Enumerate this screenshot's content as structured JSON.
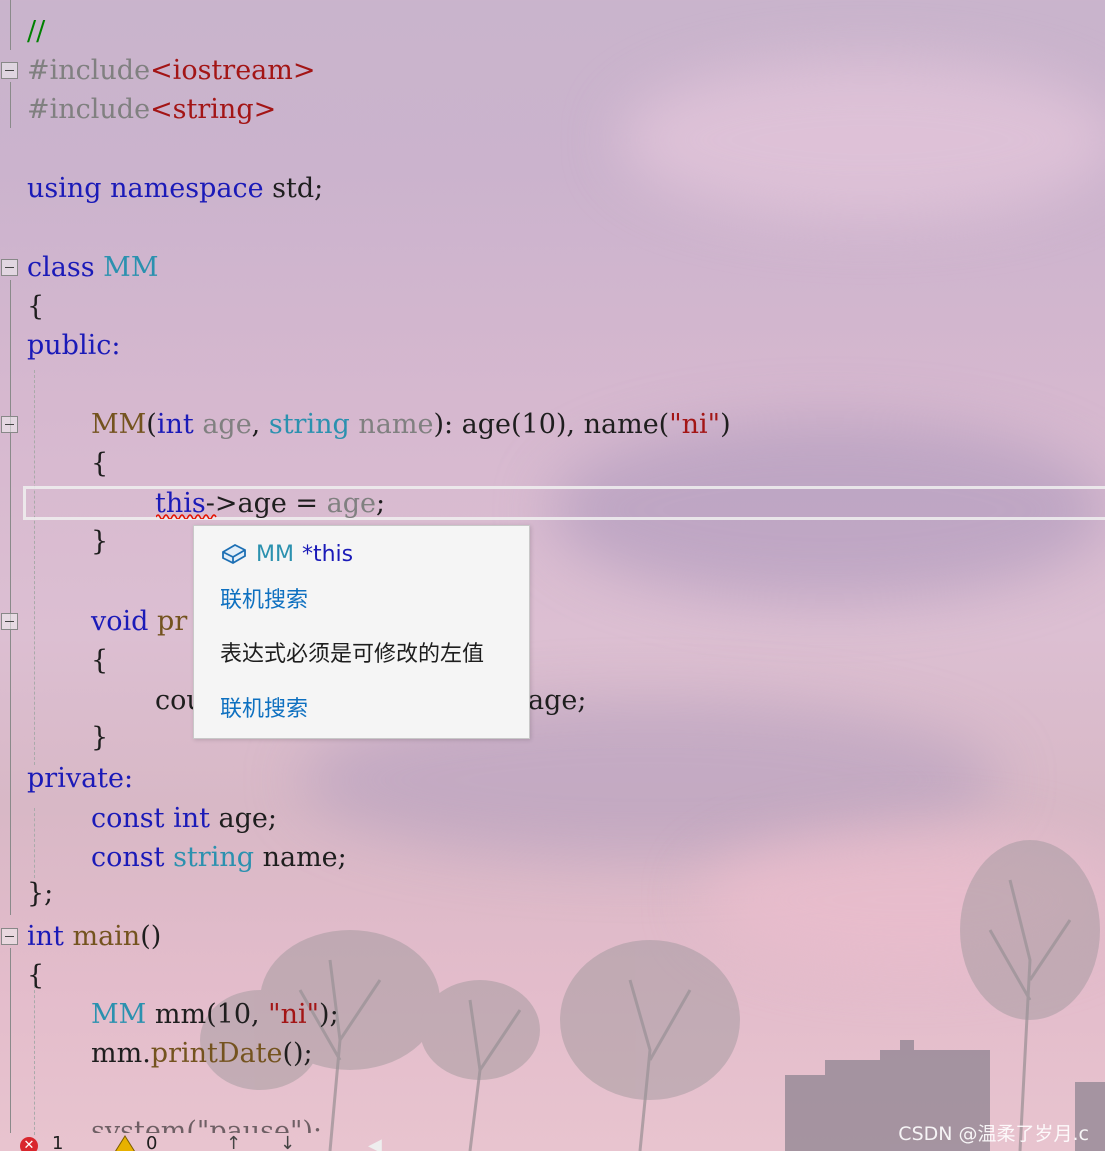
{
  "editor": {
    "code_lines": {
      "l1": "//",
      "l2a": "#include",
      "l2b": "<iostream>",
      "l3a": "#include",
      "l3b": "<string>",
      "l4a": "using",
      "l4b": "namespace",
      "l4c": "std;",
      "l5a": "class",
      "l5b": "MM",
      "l6": "{",
      "l7": "public:",
      "l8a": "MM",
      "l8b": "(",
      "l8c": "int",
      "l8d": "age",
      "l8e": ", ",
      "l8f": "string",
      "l8g": "name",
      "l8h": "): age(10), name(",
      "l8i": "\"ni\"",
      "l8j": ")",
      "l9": "{",
      "l10a": "this",
      "l10b": "->age = ",
      "l10c": "age",
      "l10d": ";",
      "l11": "}",
      "l12a": "void",
      "l12b": "pr",
      "l13": "{",
      "l14a": "cou",
      "l14b": "age;",
      "l15": "}",
      "l16": "private:",
      "l17a": "const",
      "l17b": "int",
      "l17c": "age;",
      "l18a": "const",
      "l18b": "string",
      "l18c": "name;",
      "l19": "};",
      "l20a": "int",
      "l20b": "main",
      "l20c": "()",
      "l21": "{",
      "l22a": "MM",
      "l22b": "mm",
      "l22c": "(10, ",
      "l22d": "\"ni\"",
      "l22e": ");",
      "l23a": "mm.",
      "l23b": "printDate",
      "l23c": "();",
      "l24": "system(\"pause\");"
    }
  },
  "tooltip": {
    "type_name": "MM",
    "symbol": "*this",
    "search_link_1": "联机搜索",
    "error_message": "表达式必须是可修改的左值",
    "search_link_2": "联机搜索"
  },
  "status_bar": {
    "error_icon": "error-x-icon",
    "error_count": "1",
    "warning_icon": "warning-triangle-icon",
    "warning_count": "0",
    "nav_up": "↑",
    "nav_down": "↓"
  },
  "watermark": "CSDN @温柔了岁月.c",
  "colors": {
    "keyword": "#1a1ab8",
    "type": "#2b91af",
    "preprocessor": "#808080",
    "string": "#a31515",
    "function": "#74531f",
    "link": "#0e70c0",
    "error": "#d9262d"
  }
}
